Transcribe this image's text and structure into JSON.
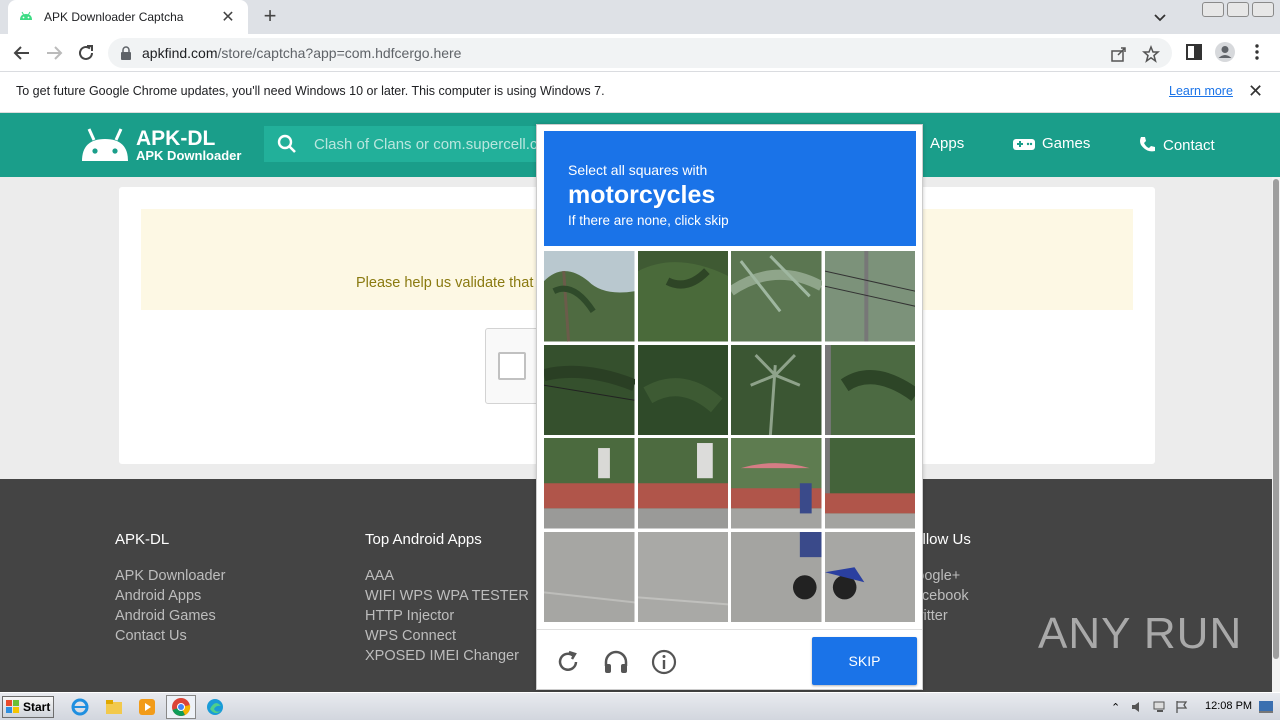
{
  "browser": {
    "tab_title": "APK Downloader Captcha",
    "url_host": "apkfind.com",
    "url_path": "/store/captcha?app=com.hdfcergo.here",
    "infobar_message": "To get future Google Chrome updates, you'll need Windows 10 or later. This computer is using Windows 7.",
    "infobar_link": "Learn more"
  },
  "site": {
    "logo_title": "APK-DL",
    "logo_subtitle": "APK Downloader",
    "search_placeholder": "Clash of Clans or com.supercell.clashofclans",
    "nav": {
      "apps": "Apps",
      "games": "Games",
      "contact": "Contact"
    },
    "notice_text": "Please help us validate that you are not a robot"
  },
  "footer": {
    "col1": {
      "title": "APK-DL",
      "links": [
        "APK Downloader",
        "Android Apps",
        "Android Games",
        "Contact Us"
      ]
    },
    "col2": {
      "title": "Top Android Apps",
      "links": [
        "AAA",
        "WIFI WPS WPA TESTER",
        "HTTP Injector",
        "WPS Connect",
        "XPOSED IMEI Changer"
      ]
    },
    "col4": {
      "title": "Follow Us",
      "links": [
        "Google+",
        "Facebook",
        "Twitter"
      ]
    },
    "watermark": "ANY RUN"
  },
  "captcha": {
    "line1": "Select all squares with",
    "target": "motorcycles",
    "line3": "If there are none, click skip",
    "skip_label": "SKIP",
    "colors": {
      "header": "#1a73e8",
      "button": "#1a73e8"
    }
  },
  "taskbar": {
    "start_label": "Start",
    "clock": "12:08 PM"
  },
  "colors": {
    "site_header": "#1a9e8a",
    "footer": "#444444",
    "notice_bg": "#fdf8e4"
  }
}
